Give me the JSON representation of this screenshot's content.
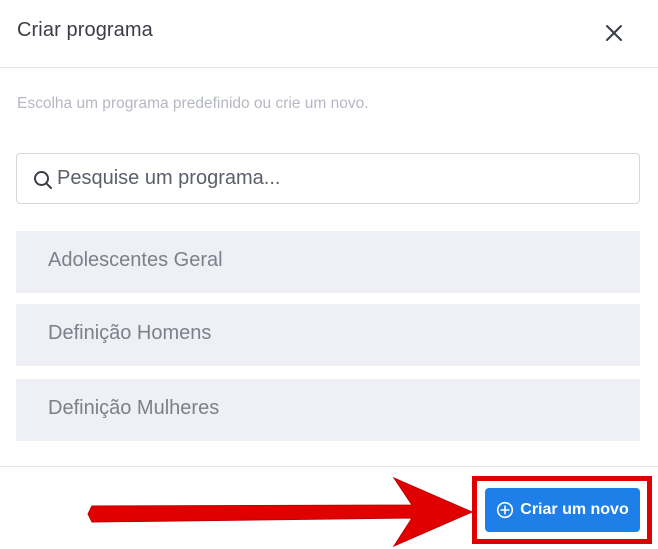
{
  "dialog": {
    "title": "Criar programa",
    "close_icon": "close-icon"
  },
  "subtitle": "Escolha um programa predefinido ou crie um novo.",
  "search": {
    "placeholder": "Pesquise um programa...",
    "value": "",
    "icon": "search-icon"
  },
  "programs": [
    {
      "label": "Adolescentes Geral"
    },
    {
      "label": "Definição Homens"
    },
    {
      "label": "Definição Mulheres"
    }
  ],
  "footer": {
    "create_label": "Criar um novo",
    "create_icon": "plus-circle-icon"
  },
  "colors": {
    "accent": "#1f7fe8",
    "list_bg": "#eef0f5",
    "annotation_red": "#e00000"
  },
  "annotation": {
    "type": "red arrow pointing to highlighted button"
  }
}
